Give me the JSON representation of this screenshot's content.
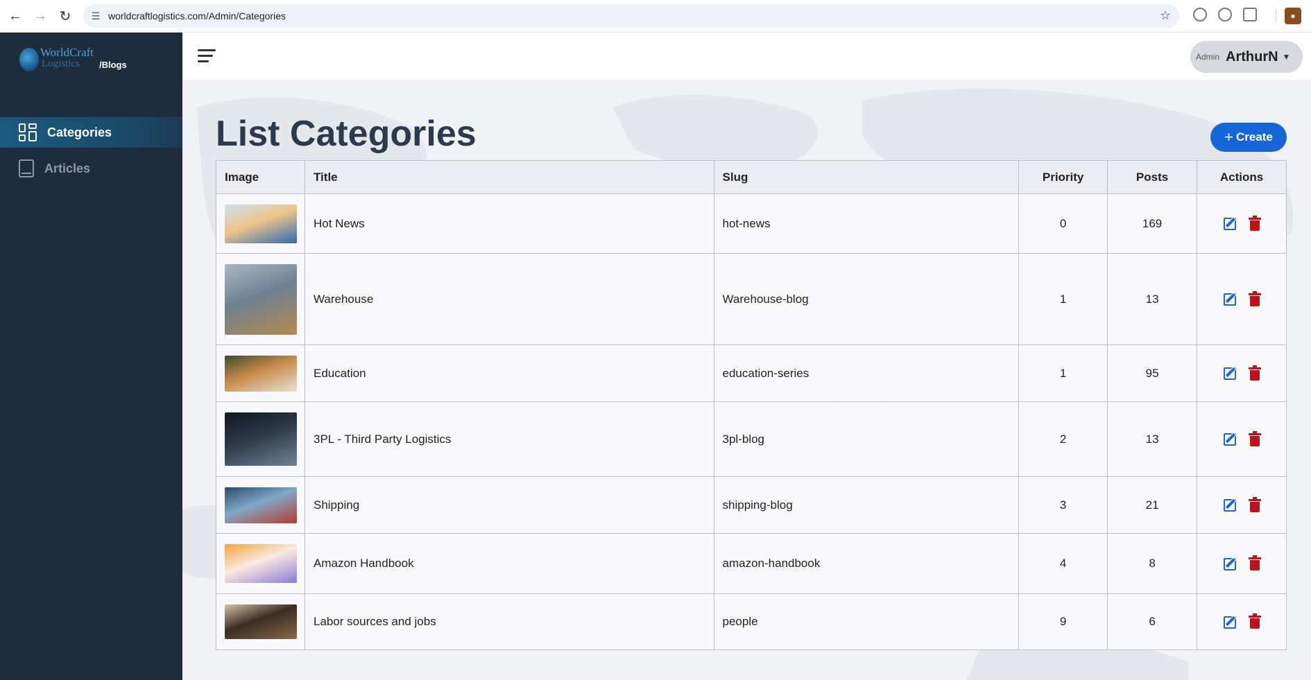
{
  "browser": {
    "url": "worldcraftlogistics.com/Admin/Categories",
    "icons": [
      "back-icon",
      "forward-icon",
      "reload-icon",
      "site-settings-icon",
      "star-icon",
      "extension-icon",
      "puzzle-icon",
      "profile-icon"
    ]
  },
  "sidebar": {
    "logo_line1": "WorldCraft",
    "logo_line2": "Logistics",
    "logo_suffix": "/Blogs",
    "items": [
      {
        "label": "Categories",
        "icon": "grid-icon",
        "active": true
      },
      {
        "label": "Articles",
        "icon": "book-icon",
        "active": false
      }
    ]
  },
  "header": {
    "avatar_alt": "Admin",
    "username": "ArthurN"
  },
  "page": {
    "title": "List Categories",
    "create_label": "Create"
  },
  "table": {
    "columns": [
      "Image",
      "Title",
      "Slug",
      "Priority",
      "Posts",
      "Actions"
    ],
    "rows": [
      {
        "title": "Hot News",
        "slug": "hot-news",
        "priority": "0",
        "posts": "169",
        "thumb": [
          "#f0c58a",
          "#2a6bb0",
          "#c9dff2"
        ]
      },
      {
        "title": "Warehouse",
        "slug": "Warehouse-blog",
        "priority": "1",
        "posts": "13",
        "thumb": [
          "#6e8192",
          "#b38a4e",
          "#aab7c4"
        ]
      },
      {
        "title": "Education",
        "slug": "education-series",
        "priority": "1",
        "posts": "95",
        "thumb": [
          "#c98a4a",
          "#e7e2d4",
          "#3b4b2e"
        ]
      },
      {
        "title": "3PL - Third Party Logistics",
        "slug": "3pl-blog",
        "priority": "2",
        "posts": "13",
        "thumb": [
          "#2c3947",
          "#6f8396",
          "#101820"
        ]
      },
      {
        "title": "Shipping",
        "slug": "shipping-blog",
        "priority": "3",
        "posts": "21",
        "thumb": [
          "#7fa8c9",
          "#b83a2a",
          "#2d4b66"
        ]
      },
      {
        "title": "Amazon Handbook",
        "slug": "amazon-handbook",
        "priority": "4",
        "posts": "8",
        "thumb": [
          "#fbe9e1",
          "#8a7bd6",
          "#f2a33a"
        ]
      },
      {
        "title": "Labor sources and jobs",
        "slug": "people",
        "priority": "9",
        "posts": "6",
        "thumb": [
          "#3a2c22",
          "#8a6a4c",
          "#d4c2a8"
        ]
      }
    ]
  }
}
